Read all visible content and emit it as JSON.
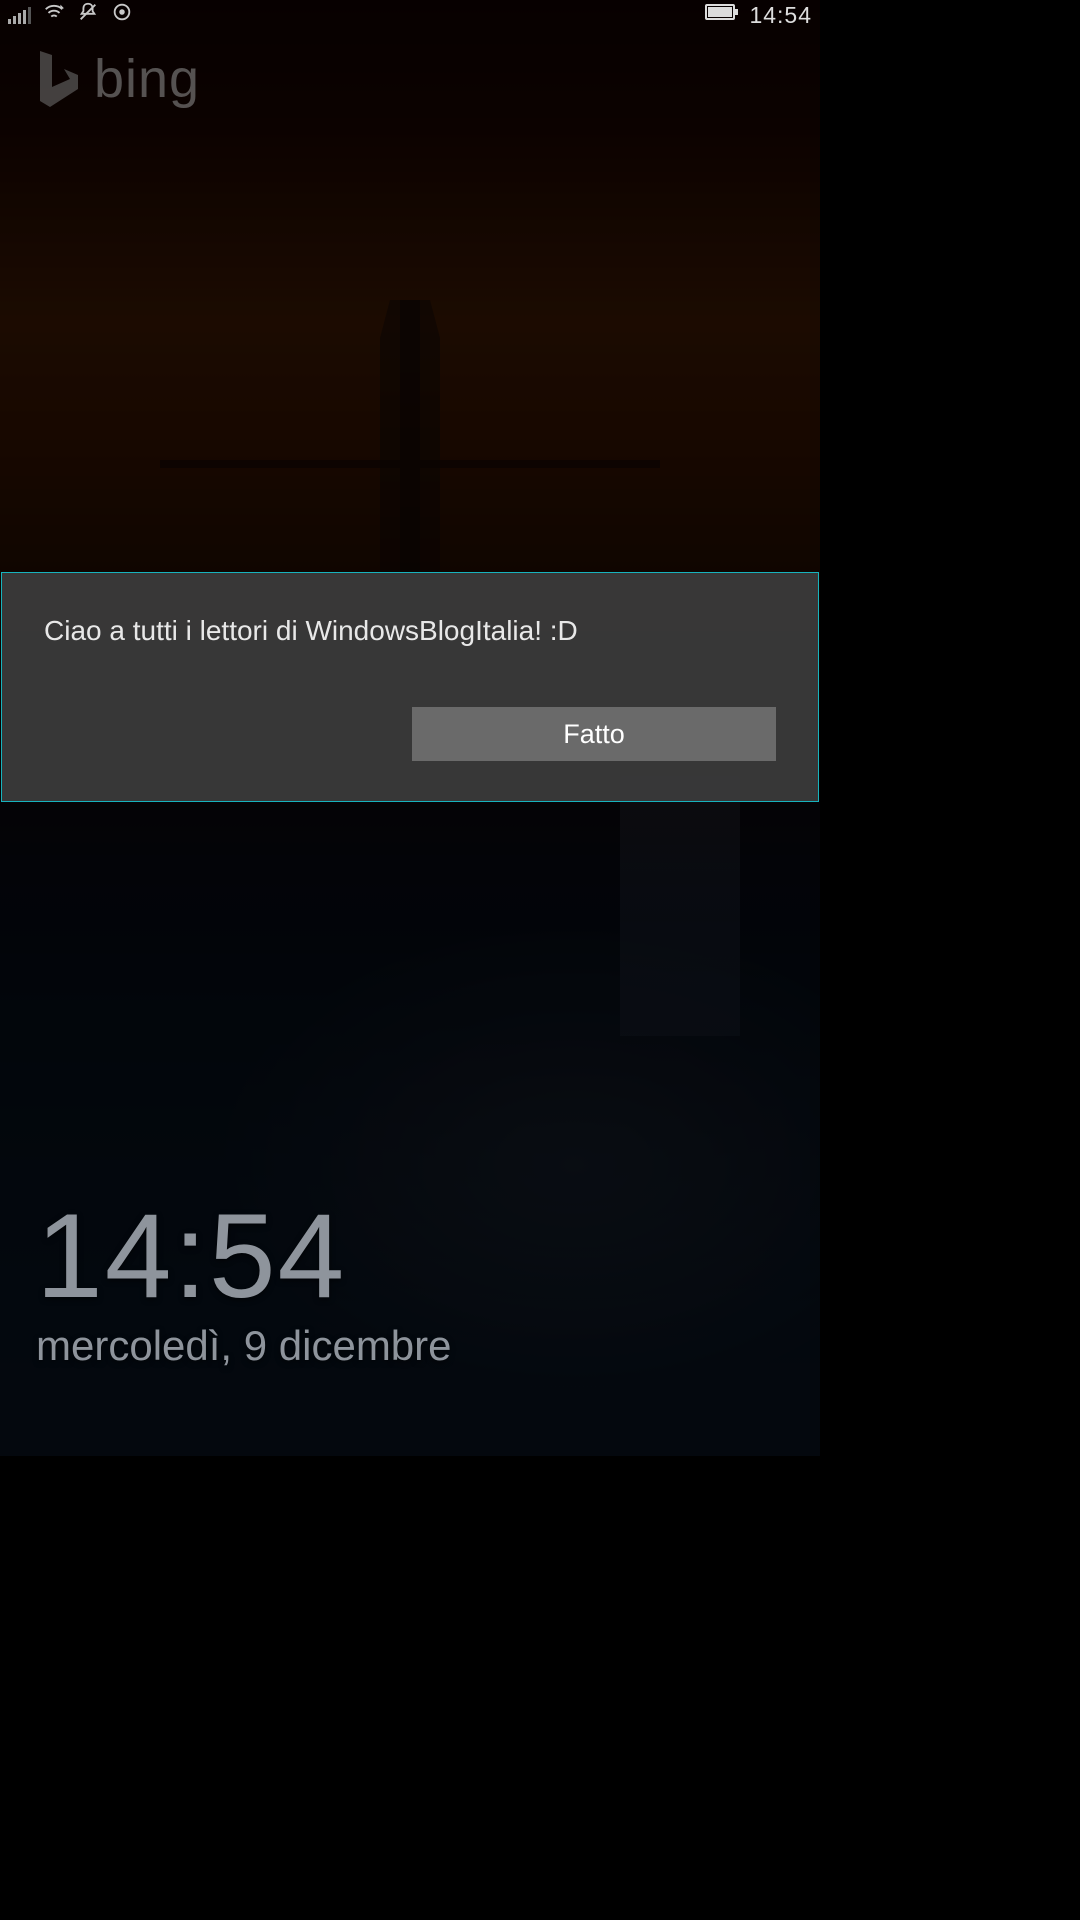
{
  "statusBar": {
    "time": "14:54",
    "icons": {
      "signal": "cellular-signal-icon",
      "wifi": "wifi-icon",
      "silent": "ringer-silent-icon",
      "location": "location-icon",
      "battery": "battery-full-icon"
    }
  },
  "bing": {
    "label": "bing"
  },
  "dialog": {
    "message": "Ciao a tutti i lettori di WindowsBlogItalia! :D",
    "buttonLabel": "Fatto"
  },
  "clock": {
    "time": "14:54",
    "date": "mercoledì, 9 dicembre"
  }
}
